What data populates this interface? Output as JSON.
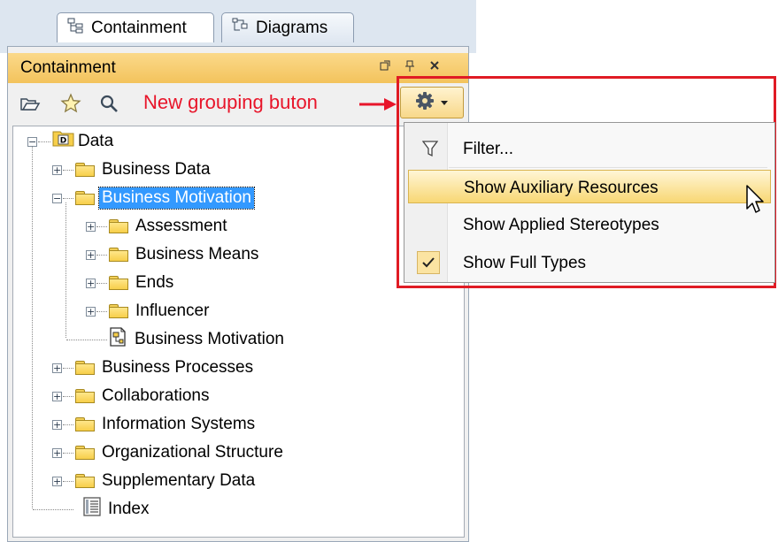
{
  "tabs": [
    {
      "label": "Containment",
      "icon": "containment-tree-icon"
    },
    {
      "label": "Diagrams",
      "icon": "diagrams-icon"
    }
  ],
  "panel": {
    "title": "Containment",
    "title_buttons": [
      "maximize-icon",
      "pin-icon",
      "close-icon"
    ]
  },
  "toolbar": {
    "icons": [
      "open-folder-icon",
      "star-icon",
      "search-icon"
    ],
    "annotation": "New grouping buton",
    "grouping_button_icons": [
      "gear-icon",
      "dropdown-arrow-icon"
    ]
  },
  "tree": {
    "root": "Data",
    "items": [
      {
        "label": "Business Data"
      },
      {
        "label": "Business Motivation"
      },
      {
        "label": "Assessment"
      },
      {
        "label": "Business Means"
      },
      {
        "label": "Ends"
      },
      {
        "label": "Influencer"
      },
      {
        "label": "Business Motivation"
      },
      {
        "label": "Business Processes"
      },
      {
        "label": "Collaborations"
      },
      {
        "label": "Information Systems"
      },
      {
        "label": "Organizational Structure"
      },
      {
        "label": "Supplementary Data"
      },
      {
        "label": "Index"
      }
    ]
  },
  "menu": {
    "items": [
      {
        "label": "Filter...",
        "icon": "filter-icon"
      },
      {
        "label": "Show Auxiliary Resources",
        "highlighted": true
      },
      {
        "label": "Show Applied Stereotypes"
      },
      {
        "label": "Show Full Types",
        "checked": true
      }
    ]
  },
  "colors": {
    "annotation_red": "#e8152a",
    "selection_blue": "#3399ff",
    "titlebar_orange": "#f3c35c"
  }
}
